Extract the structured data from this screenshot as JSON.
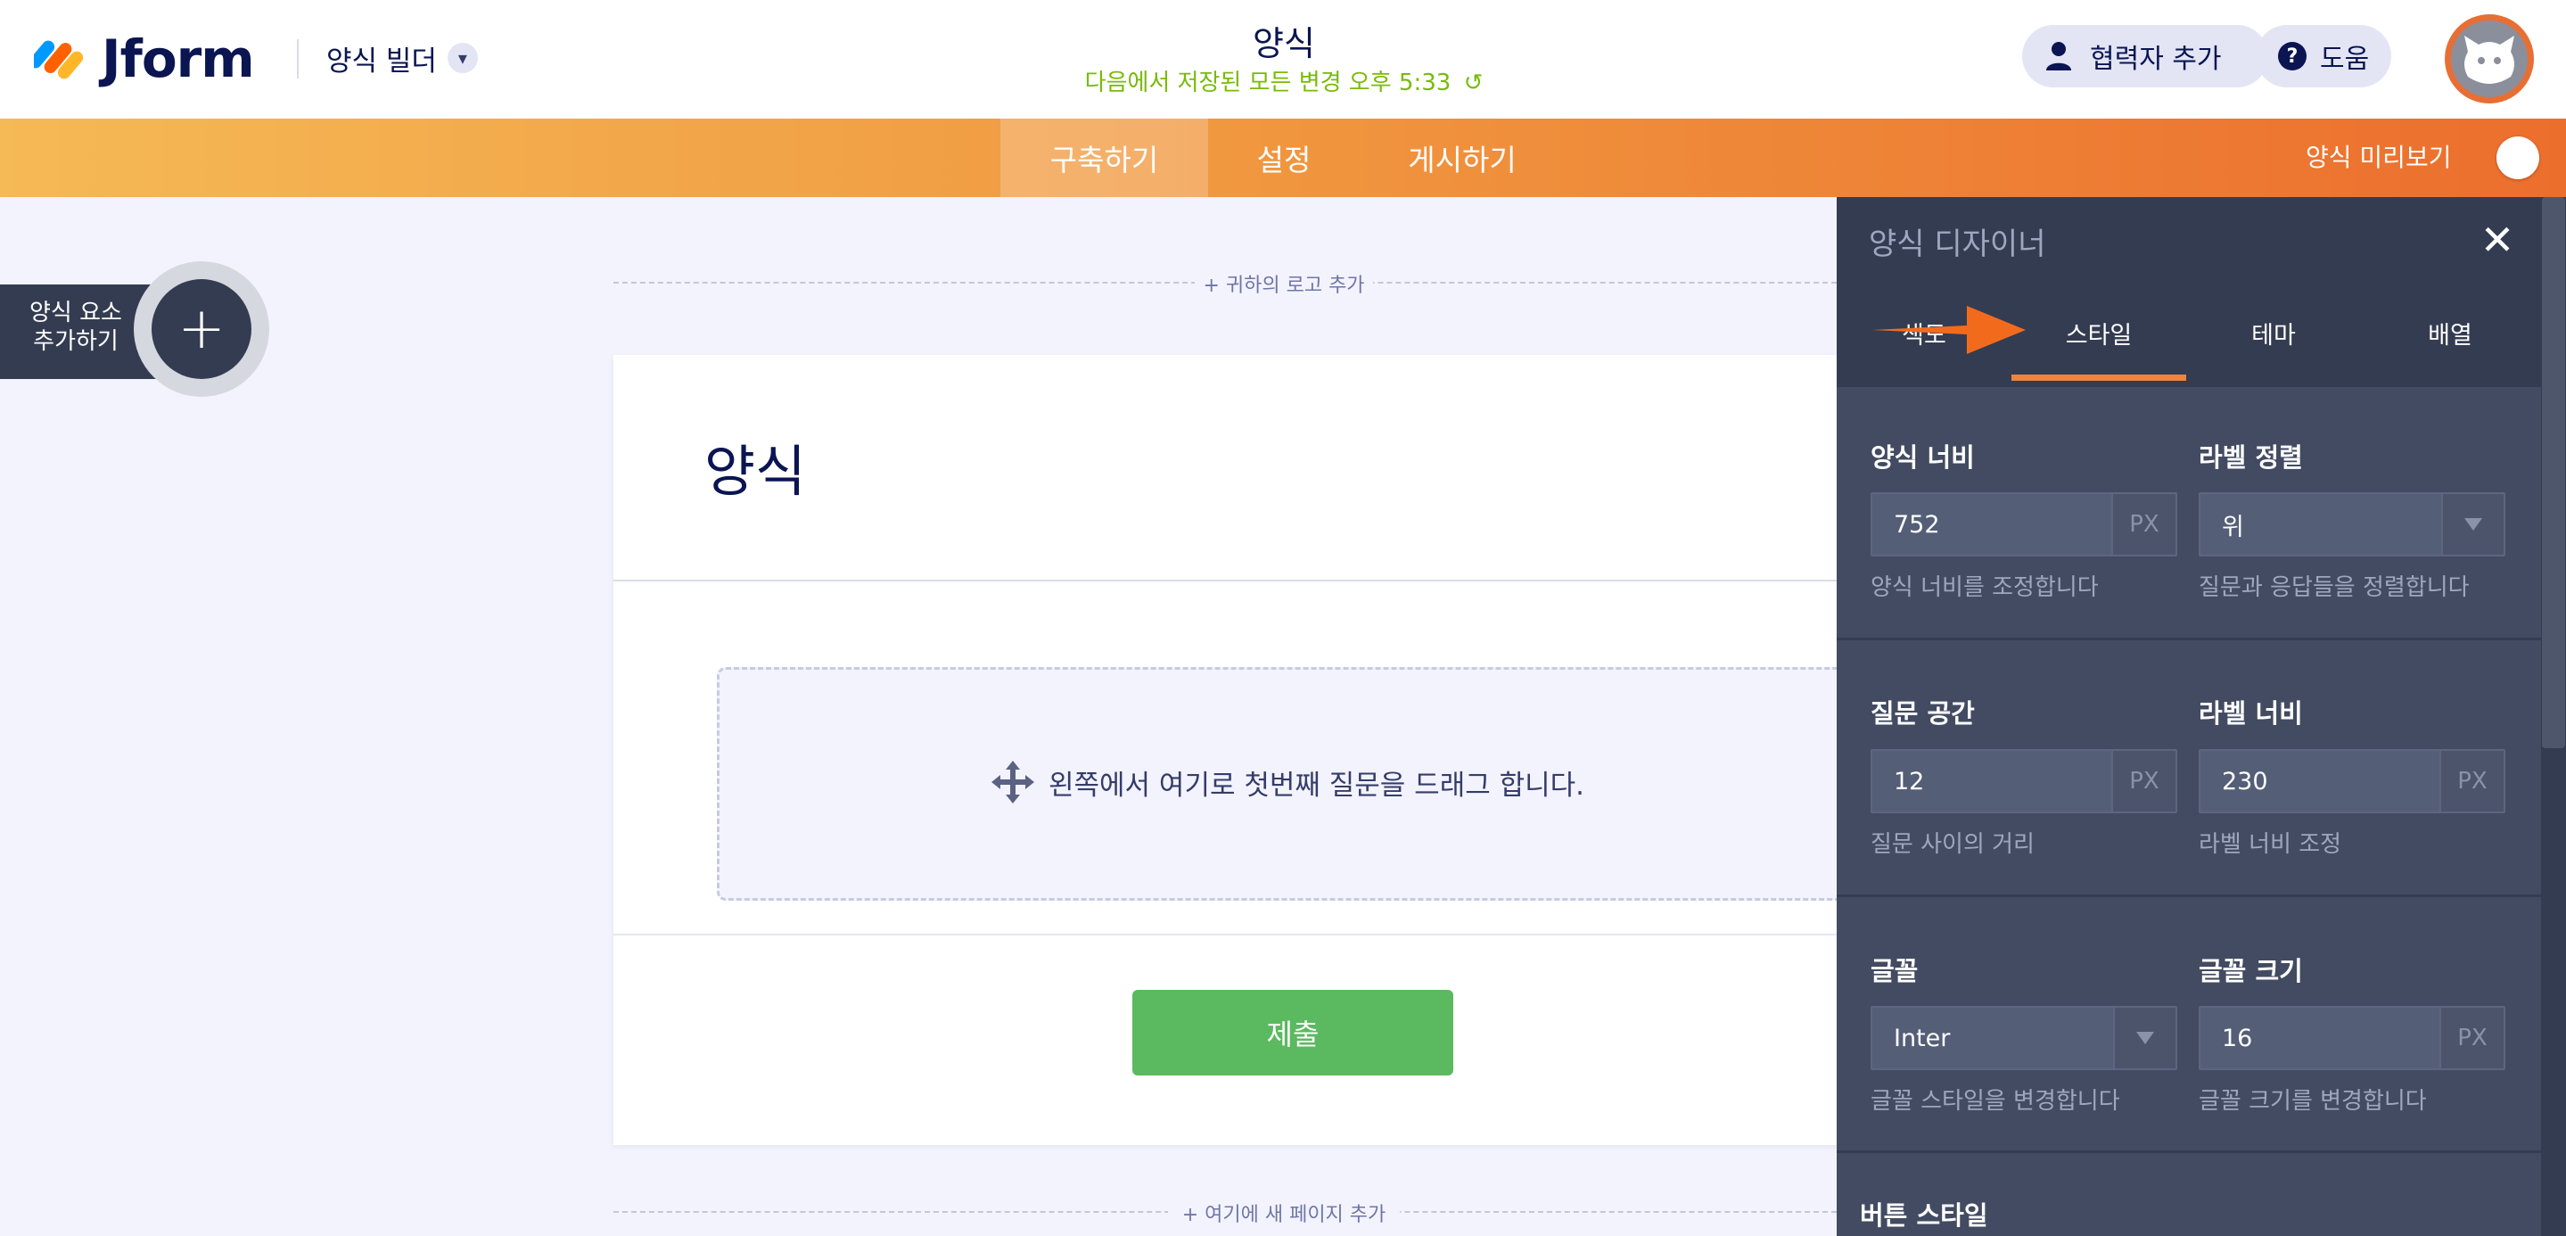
{
  "header": {
    "brand": "Jform",
    "builder_label": "양식 빌더",
    "form_title": "양식",
    "save_status": "다음에서 저장된 모든 변경 오후 5:33",
    "collaborator_label": "협력자 추가",
    "help_label": "도움"
  },
  "nav": {
    "tabs": [
      "구축하기",
      "설정",
      "게시하기"
    ],
    "active_tab": "구축하기",
    "preview_label": "양식 미리보기",
    "preview_enabled": false,
    "bar_gradient": [
      "#f5b955",
      "#ec6e2d"
    ]
  },
  "left_panel": {
    "add_element_label": "양식 요소 추가하기"
  },
  "canvas": {
    "logo_add": "+ 귀하의 로고 추가",
    "form_heading": "양식",
    "drop_hint": "왼쪽에서 여기로 첫번째 질문을 드래그 합니다.",
    "submit_label": "제출",
    "page_add": "+ 여기에 새 페이지 추가"
  },
  "designer": {
    "title": "양식 디자이너",
    "tabs": [
      "색도",
      "스타일",
      "테마",
      "배열"
    ],
    "active_tab": "스타일",
    "fields": {
      "form_width": {
        "label": "양식 너비",
        "value": "752",
        "unit": "PX",
        "hint": "양식 너비를 조정합니다"
      },
      "label_align": {
        "label": "라벨 정렬",
        "value": "위",
        "hint": "질문과 응답들을 정렬합니다"
      },
      "question_spacing": {
        "label": "질문 공간",
        "value": "12",
        "unit": "PX",
        "hint": "질문 사이의 거리"
      },
      "label_width": {
        "label": "라벨 너비",
        "value": "230",
        "unit": "PX",
        "hint": "라벨 너비 조정"
      },
      "font": {
        "label": "글꼴",
        "value": "Inter",
        "hint": "글꼴 스타일을 변경합니다"
      },
      "font_size": {
        "label": "글꼴 크기",
        "value": "16",
        "unit": "PX",
        "hint": "글꼴 크기를 변경합니다"
      },
      "button_style": {
        "label": "버튼 스타일"
      }
    }
  },
  "colors": {
    "accent_orange": "#f0843c",
    "submit_green": "#5bb960",
    "save_green": "#78bb07",
    "panel_dark": "#343c51"
  }
}
